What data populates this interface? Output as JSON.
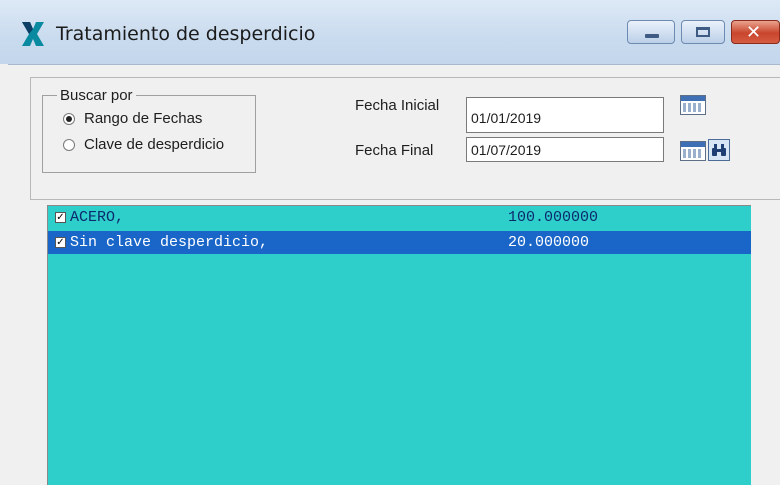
{
  "window": {
    "title": "Tratamiento de desperdicio",
    "icon": "app-logo-icon"
  },
  "search": {
    "group_label": "Buscar por",
    "options": [
      {
        "label": "Rango de Fechas",
        "selected": true
      },
      {
        "label": "Clave de desperdicio",
        "selected": false
      }
    ]
  },
  "dates": {
    "start_label": "Fecha Inicial",
    "start_value": "01/01/2019",
    "end_label": "Fecha Final",
    "end_value": "01/07/2019"
  },
  "list": {
    "rows": [
      {
        "name": "ACERO,",
        "quantity": "100.000000",
        "checked": true,
        "selected": false
      },
      {
        "name": "Sin clave desperdicio,",
        "quantity": "20.000000",
        "checked": true,
        "selected": true
      }
    ]
  },
  "colors": {
    "list_background": "#2ecfcb",
    "selection": "#1966c8",
    "close_button": "#c9452d"
  }
}
